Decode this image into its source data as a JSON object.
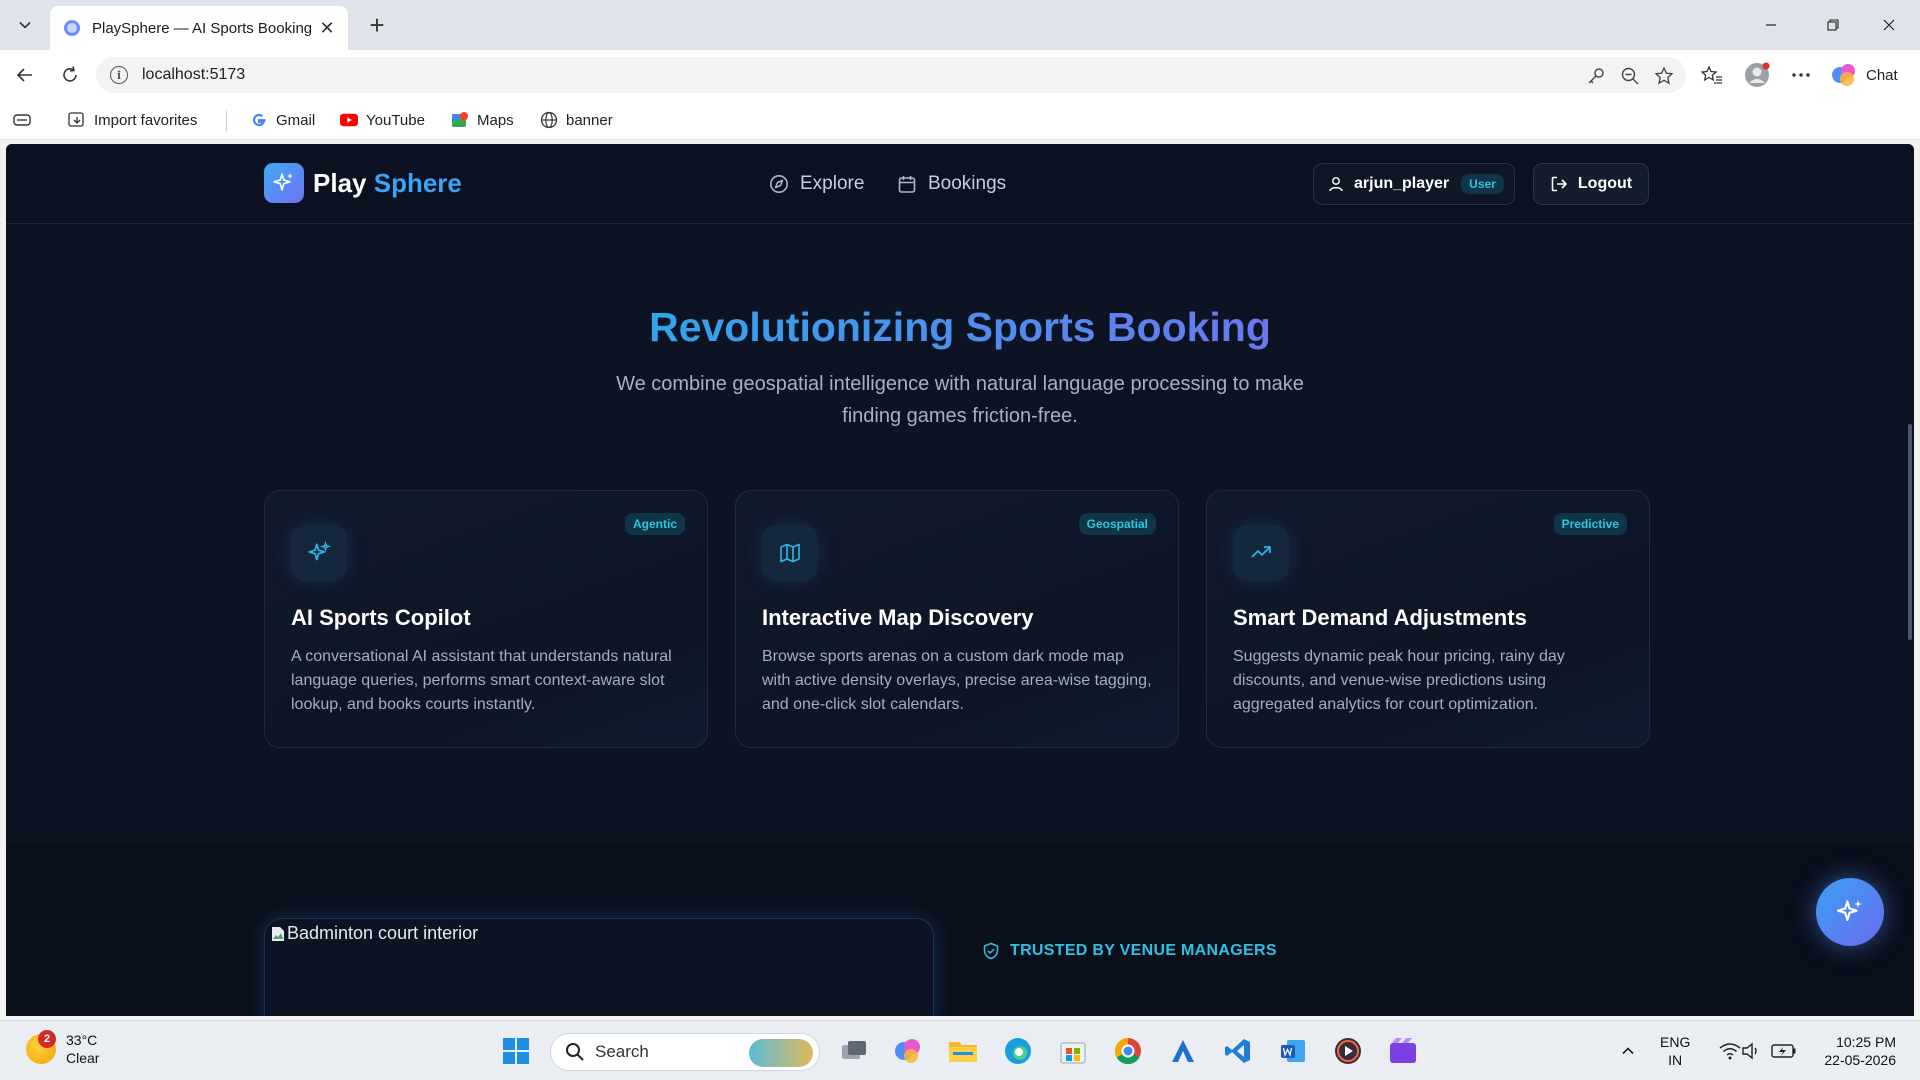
{
  "browser": {
    "tab_title": "PlaySphere — AI Sports Booking",
    "tab_close": "✕",
    "new_tab": "+",
    "url": "localhost:5173",
    "chat_label": "Chat",
    "bookmarks": [
      {
        "label": "Import favorites"
      },
      {
        "label": "Gmail"
      },
      {
        "label": "YouTube"
      },
      {
        "label": "Maps"
      },
      {
        "label": "banner"
      }
    ]
  },
  "app": {
    "logo_main": "Play",
    "logo_accent": "Sphere",
    "nav": [
      {
        "label": "Explore",
        "icon": "compass-icon"
      },
      {
        "label": "Bookings",
        "icon": "calendar-icon"
      }
    ],
    "user": {
      "name": "arjun_player",
      "role": "User"
    },
    "logout_label": "Logout"
  },
  "hero": {
    "title": "Revolutionizing Sports Booking",
    "subtitle": "We combine geospatial intelligence with natural language processing to make finding games friction-free."
  },
  "features": [
    {
      "badge": "Agentic",
      "title": "AI Sports Copilot",
      "description": "A conversational AI assistant that understands natural language queries, performs smart context-aware slot lookup, and books courts instantly.",
      "icon": "sparkles-icon"
    },
    {
      "badge": "Geospatial",
      "title": "Interactive Map Discovery",
      "description": "Browse sports arenas on a custom dark mode map with active density overlays, precise area-wise tagging, and one-click slot calendars.",
      "icon": "map-icon"
    },
    {
      "badge": "Predictive",
      "title": "Smart Demand Adjustments",
      "description": "Suggests dynamic peak hour pricing, rainy day discounts, and venue-wise predictions using aggregated analytics for court optimization.",
      "icon": "trending-up-icon"
    }
  ],
  "lower": {
    "image_alt": "Badminton court interior",
    "trusted_label": "TRUSTED BY VENUE MANAGERS"
  },
  "taskbar": {
    "weather_badge": "2",
    "temperature": "33°C",
    "condition": "Clear",
    "search_placeholder": "Search",
    "lang_top": "ENG",
    "lang_bottom": "IN",
    "time": "10:25 PM",
    "date": "22-05-2026"
  },
  "colors": {
    "accent_blue": "#3aa4f6",
    "accent_cyan": "#2ec6e0",
    "page_bg": "#0c1322"
  }
}
